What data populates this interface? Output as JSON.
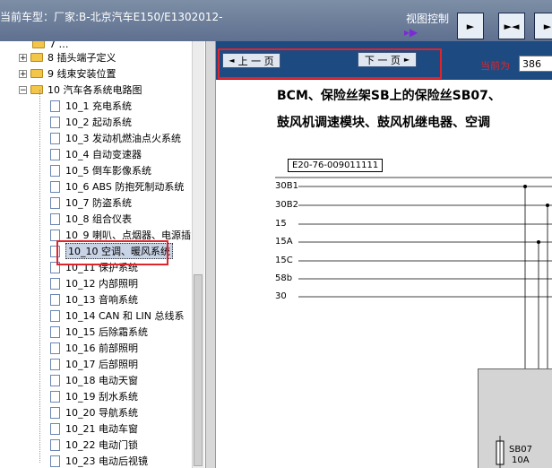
{
  "header": {
    "model_label": "当前车型：厂家:B-北京汽车E150/E1302012-",
    "view_control": "视图控制",
    "nav_buttons": [
      "►",
      "►◄",
      "►"
    ]
  },
  "sidebar": {
    "partial_top_label": "7 …",
    "items": [
      {
        "label": "8 插头端子定义",
        "type": "folder",
        "expander": "+"
      },
      {
        "label": "9 线束安装位置",
        "type": "folder",
        "expander": "+"
      },
      {
        "label": "10 汽车各系统电路图",
        "type": "folder",
        "expander": "−"
      }
    ],
    "subitems": [
      "10_1 充电系统",
      "10_2 起动系统",
      "10_3 发动机燃油点火系统",
      "10_4 自动变速器",
      "10_5 倒车影像系统",
      "10_6 ABS 防抱死制动系统",
      "10_7 防盗系统",
      "10_8 组合仪表",
      "10_9 喇叭、点烟器、电源插",
      "10_10 空调、暖风系统",
      "10_11 保护系统",
      "10_12 内部照明",
      "10_13 音响系统",
      "10_14 CAN 和 LIN 总线系",
      "10_15 后除霜系统",
      "10_16 前部照明",
      "10_17 后部照明",
      "10_18 电动天窗",
      "10_19 刮水系统",
      "10_20 导航系统",
      "10_21 电动车窗",
      "10_22 电动门锁",
      "10_23 电动后视镜"
    ],
    "selected_index": 9
  },
  "pager": {
    "prev_label": "上 一 页",
    "next_label": "下 一 页",
    "current_label": "当前为",
    "current_value": "386"
  },
  "content": {
    "title_line1": "BCM、保险丝架SB上的保险丝SB07、",
    "title_line2": "鼓风机调速模块、鼓风机继电器、空调",
    "diagram_code": "E20-76-009011111",
    "bus_labels": [
      "30B1",
      "30B2",
      "15",
      "15A",
      "15C",
      "58b",
      "30"
    ],
    "fuse_name": "SB07",
    "fuse_rating": "10A"
  },
  "colors": {
    "highlight_red": "#e0242c",
    "pager_bg": "#1d4a80",
    "topbar": "#6b7b96"
  }
}
